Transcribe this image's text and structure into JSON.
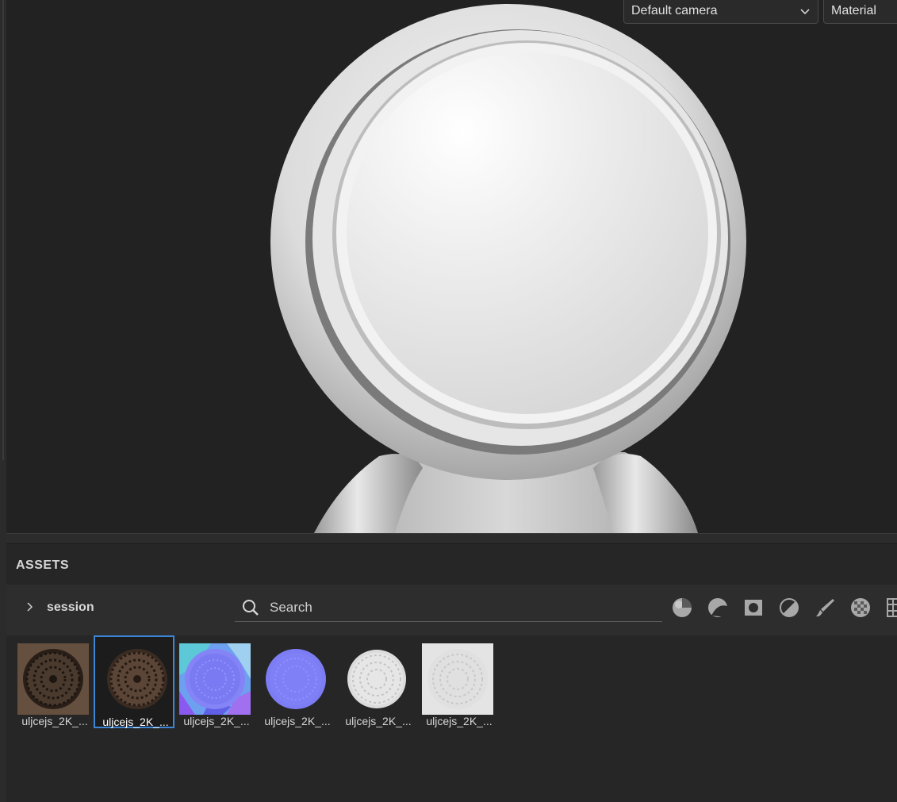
{
  "viewport": {
    "camera_select": "Default camera",
    "mode_select": "Material"
  },
  "assets": {
    "title": "ASSETS",
    "session_label": "session",
    "search_placeholder": "Search",
    "filters": [
      {
        "icon": "material-sphere-icon"
      },
      {
        "icon": "smart-material-icon"
      },
      {
        "icon": "mask-icon"
      },
      {
        "icon": "generator-icon"
      },
      {
        "icon": "brush-icon"
      },
      {
        "icon": "alpha-texture-icon"
      },
      {
        "icon": "grid-pattern-icon"
      }
    ],
    "items": [
      {
        "label": "uljcejs_2K_...",
        "kind": "basecolor-square"
      },
      {
        "label": "uljcejs_2K_...",
        "kind": "basecolor-round",
        "selected": true
      },
      {
        "label": "uljcejs_2K_...",
        "kind": "normal-square"
      },
      {
        "label": "uljcejs_2K_...",
        "kind": "normal-round"
      },
      {
        "label": "uljcejs_2K_...",
        "kind": "height-round"
      },
      {
        "label": "uljcejs_2K_...",
        "kind": "height-square"
      }
    ]
  },
  "colors": {
    "accent": "#3d86d6",
    "panel": "#262626",
    "viewport_bg": "#222222"
  }
}
